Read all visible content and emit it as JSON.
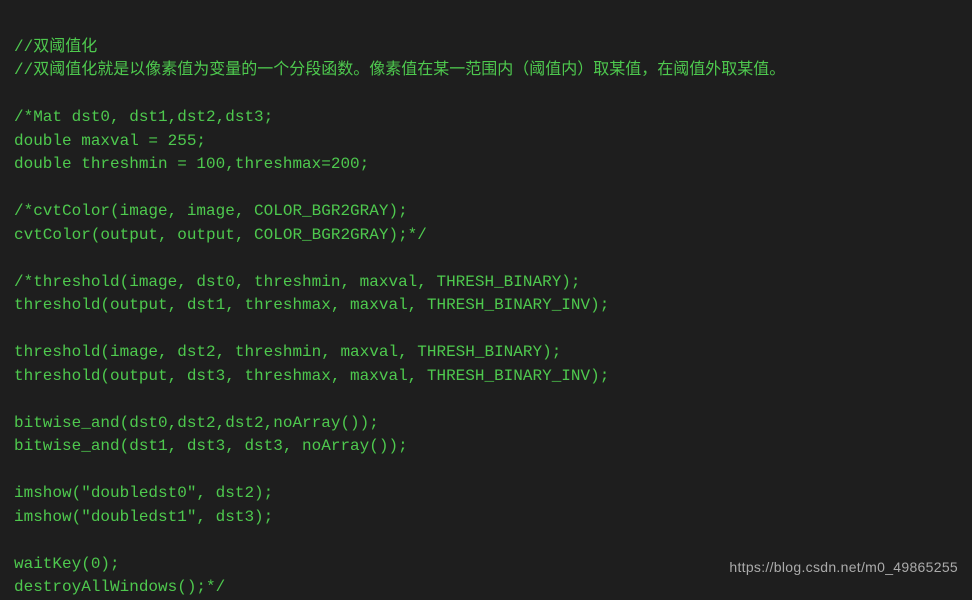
{
  "code": {
    "lines": [
      "//双阈值化",
      "//双阈值化就是以像素值为变量的一个分段函数。像素值在某一范围内（阈值内）取某值，在阈值外取某值。",
      "",
      "/*Mat dst0, dst1,dst2,dst3;",
      "double maxval = 255;",
      "double threshmin = 100,threshmax=200;",
      "",
      "/*cvtColor(image, image, COLOR_BGR2GRAY);",
      "cvtColor(output, output, COLOR_BGR2GRAY);*/",
      "",
      "/*threshold(image, dst0, threshmin, maxval, THRESH_BINARY);",
      "threshold(output, dst1, threshmax, maxval, THRESH_BINARY_INV);",
      "",
      "threshold(image, dst2, threshmin, maxval, THRESH_BINARY);",
      "threshold(output, dst3, threshmax, maxval, THRESH_BINARY_INV);",
      "",
      "bitwise_and(dst0,dst2,dst2,noArray());",
      "bitwise_and(dst1, dst3, dst3, noArray());",
      "",
      "imshow(\"doubledst0\", dst2);",
      "imshow(\"doubledst1\", dst3);",
      "",
      "waitKey(0);",
      "destroyAllWindows();*/"
    ]
  },
  "watermark": "https://blog.csdn.net/m0_49865255"
}
